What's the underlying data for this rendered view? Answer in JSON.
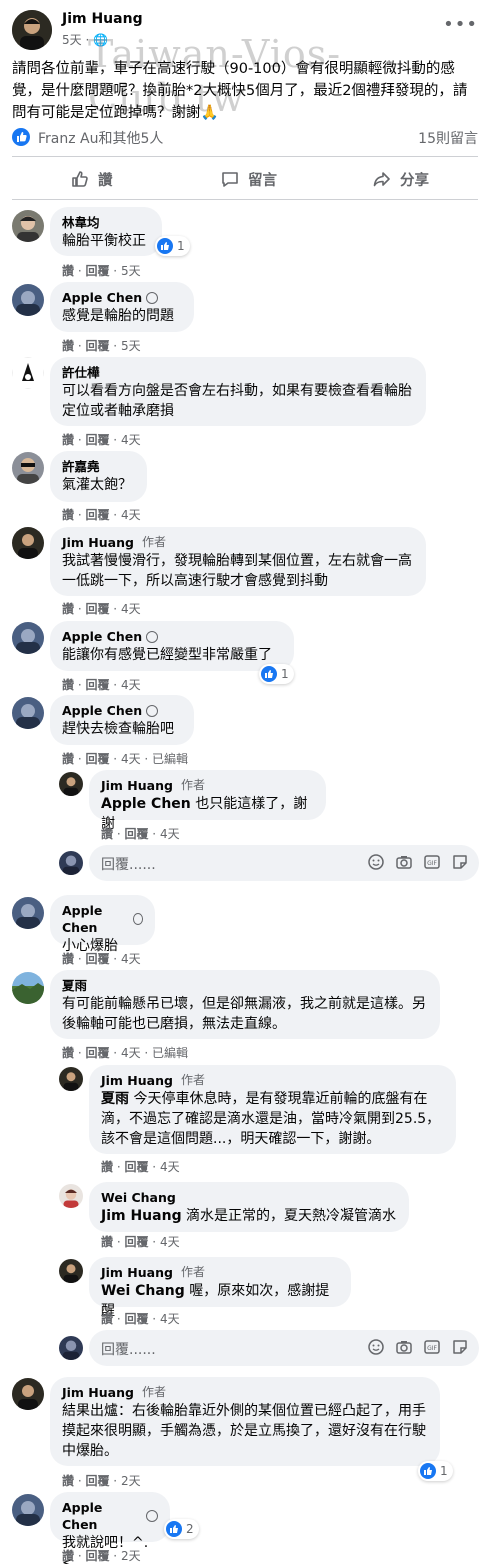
{
  "post": {
    "author": "Jim Huang",
    "time": "5天",
    "watermark": "Taiwan-Vios-Club.tw",
    "text": "請問各位前輩，車子在高速行駛（90-100）會有很明顯輕微抖動的感覺，是什麼問題呢？換前胎*2大概快5個月了，最近2個禮拜發現的，請問有可能是定位跑掉嗎？謝謝🙏",
    "reactions_names": "Franz Au和其他5人",
    "comment_count": "15則留言"
  },
  "actions": {
    "like": "讚",
    "comment": "留言",
    "share": "分享"
  },
  "labels": {
    "like": "讚",
    "reply": "回覆",
    "edited": "已編輯",
    "author": "作者",
    "reply_placeholder": "回覆......"
  },
  "comments": [
    {
      "name": "林韋均",
      "text": "輪胎平衡校正",
      "time": "5天",
      "likes": "1"
    },
    {
      "name": "Apple Chen",
      "text": "感覺是輪胎的問題",
      "time": "5天"
    },
    {
      "name": "許仕樺",
      "text": "可以看看方向盤是否會左右抖動，如果有要檢查看看輪胎定位或者軸承磨損",
      "time": "4天"
    },
    {
      "name": "許嘉堯",
      "text": "氣灌太飽？",
      "time": "4天"
    },
    {
      "name": "Jim Huang",
      "text": "我試著慢慢滑行，發現輪胎轉到某個位置，左右就會一高一低跳一下，所以高速行駛才會感覺到抖動",
      "time": "4天"
    },
    {
      "name": "Apple Chen",
      "text": "能讓你有感覺已經變型非常嚴重了",
      "time": "4天",
      "likes": "1"
    },
    {
      "name": "Apple Chen",
      "text": "趕快去檢查輪胎吧",
      "time": "4天"
    },
    {
      "name": "Jim Huang",
      "mention": "Apple Chen",
      "text": "也只能這樣了，謝謝",
      "time": "4天"
    },
    {
      "name": "Apple Chen",
      "text": "小心爆胎",
      "time": "4天"
    },
    {
      "name": "夏雨",
      "text": "有可能前輪懸吊已壞，但是卻無漏液，我之前就是這樣。另後輪軸可能也已磨損，無法走直線。",
      "time": "4天"
    },
    {
      "name": "Jim Huang",
      "mention": "夏雨",
      "text": "今天停車休息時，是有發現靠近前輪的底盤有在滴，不過忘了確認是滴水還是油，當時冷氣開到25.5，該不會是這個問題...，明天確認一下，謝謝。",
      "time": "4天"
    },
    {
      "name": "Wei Chang",
      "mention": "Jim Huang",
      "text": "滴水是正常的，夏天熱冷凝管滴水",
      "time": "4天"
    },
    {
      "name": "Jim Huang",
      "mention": "Wei Chang",
      "text": "喔，原來如次，感謝提醒",
      "time": "4天"
    },
    {
      "name": "Jim Huang",
      "text": "結果出爐：右後輪胎靠近外側的某個位置已經凸起了，用手摸起來很明顯，手觸為憑，於是立馬換了，還好沒有在行駛中爆胎。",
      "time": "2天",
      "likes": "1"
    },
    {
      "name": "Apple Chen",
      "text": "我就說吧！^.<",
      "time": "2天",
      "likes": "2"
    }
  ],
  "colors": {
    "accent": "#1877f2",
    "bubble": "#f0f2f5",
    "muted": "#65676b"
  }
}
